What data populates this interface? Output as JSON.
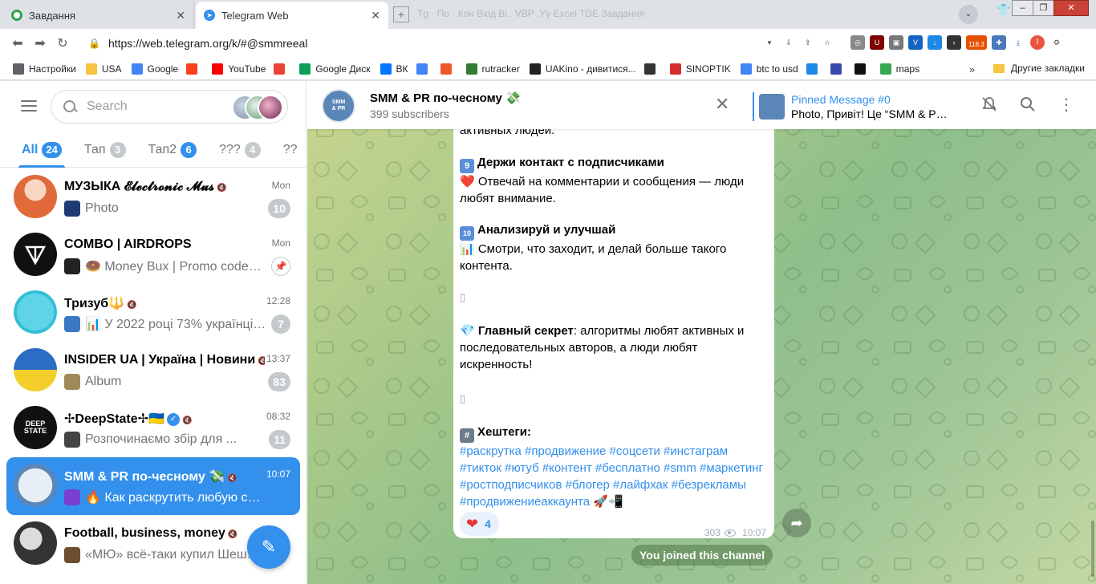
{
  "browser": {
    "tabs": [
      {
        "label": "Завдання"
      },
      {
        "label": "Telegram Web"
      }
    ],
    "ghost_tabs": "Tg · По ·  Кон  Вхід Bi..  VBP .Yy  Excel TDE  Завдання",
    "url": "https://web.telegram.org/k/#@smmreeal",
    "extension_badge": "118.3",
    "profile_initial": "I",
    "bookmarks": [
      {
        "label": "Настройки",
        "icon": "gear-icon",
        "color": "#5f6368"
      },
      {
        "label": "USA",
        "icon": "folder-icon",
        "color": "#f6c343"
      },
      {
        "label": "Google",
        "icon": "google-icon",
        "color": "#4285f4"
      },
      {
        "label": "",
        "icon": "yandex-icon",
        "color": "#fc3f1d"
      },
      {
        "label": "YouTube",
        "icon": "youtube-icon",
        "color": "#ff0000"
      },
      {
        "label": "",
        "icon": "gmail-icon",
        "color": "#ea4335"
      },
      {
        "label": "Google Диск",
        "icon": "drive-icon",
        "color": "#0f9d58"
      },
      {
        "label": "ВК",
        "icon": "vk-icon",
        "color": "#0077ff"
      },
      {
        "label": "",
        "icon": "translate-icon",
        "color": "#4285f4"
      },
      {
        "label": "",
        "icon": "f-icon",
        "color": "#f05a28"
      },
      {
        "label": "rutracker",
        "icon": "rutracker-icon",
        "color": "#2e7d32"
      },
      {
        "label": "UAKino - дивитися...",
        "icon": "uakino-icon",
        "color": "#222222"
      },
      {
        "label": "",
        "icon": "chess-icon",
        "color": "#333333"
      },
      {
        "label": "SINOPTIK",
        "icon": "thermometer-icon",
        "color": "#d32f2f"
      },
      {
        "label": "btc to usd",
        "icon": "google-icon",
        "color": "#4285f4"
      },
      {
        "label": "",
        "icon": "p-icon",
        "color": "#1e88e5"
      },
      {
        "label": "",
        "icon": "k-icon",
        "color": "#3949ab"
      },
      {
        "label": "",
        "icon": "bc-icon",
        "color": "#111111"
      },
      {
        "label": "maps",
        "icon": "maps-icon",
        "color": "#34a853"
      }
    ],
    "bookmarks_more": "»",
    "other_bookmarks": "Другие закладки"
  },
  "sidebar": {
    "search_placeholder": "Search",
    "folders": [
      {
        "label": "All",
        "count": "24",
        "active": true
      },
      {
        "label": "Тап",
        "count": "3"
      },
      {
        "label": "Тап2",
        "count": "6",
        "blue": true
      },
      {
        "label": "???",
        "count": "4"
      },
      {
        "label": "??",
        "count": ""
      }
    ],
    "chats": [
      {
        "title": "МУЗЫКА 𝓔𝓵𝓮𝓬𝓽𝓻𝓸𝓷𝓲𝓬 𝓜𝓾𝓼",
        "time": "Mon",
        "preview": "Photo",
        "badge": "10",
        "muted": true
      },
      {
        "title": "COMBO | AIRDROPS",
        "time": "Mon",
        "preview": "🍩 Money Bux | Promo codes ...",
        "badge": "",
        "pinned": true
      },
      {
        "title": "Тризуб🔱",
        "time": "12:28",
        "preview": "📊 У 2022 році 73% українців бу...",
        "badge": "7",
        "muted": true
      },
      {
        "title": "INSIDER UA | Україна | Новини",
        "time": "13:37",
        "preview": "Album",
        "badge": "83",
        "muted": true
      },
      {
        "title": "✢DeepState✢🇺🇦",
        "time": "08:32",
        "preview": "Розпочинаємо збір для ...",
        "badge": "11",
        "muted": true,
        "verified": true
      },
      {
        "title": "SMM & PR по-чесному 💸",
        "time": "10:07",
        "preview": "🔥 Как раскрутить любую соцсе...",
        "badge": "",
        "selected": true,
        "muted": true
      },
      {
        "title": "Football, business, money",
        "time": "",
        "preview": "«МЮ» всё-таки купил Шеш...",
        "badge": "",
        "muted": true
      }
    ]
  },
  "chat": {
    "title": "SMM & PR по-чесному 💸",
    "subtitle": "399 subscribers",
    "pinned_title": "Pinned Message #0",
    "pinned_text": "Photo, Привіт! Це “SMM & PR ...",
    "message": {
      "top_fragment": "активных людей.",
      "tip9_num": "9",
      "tip9_title": "Держи контакт с подписчиками",
      "tip9_body": "❤️ Отвечай на комментарии и сообщения — люди любят внимание.",
      "tip10_num": "10",
      "tip10_title": "Анализируй и улучшай",
      "tip10_body": "📊 Смотри, что заходит, и делай больше такого контента.",
      "tofu1": "▯",
      "secret_label": "Главный секрет",
      "secret_body": ": алгоритмы любят активных и последовательных авторов, а люди любят искренность!",
      "tofu2": "▯",
      "hashtags_title": "Хештеги:",
      "hashtags": "#раскрутка #продвижение #соцсети #инстаграм #тикток #ютуб #контент #бесплатно #smm #маркетинг #ростподписчиков #блогер #лайфхак #безрекламы #продвижениеаккаунта 🚀📲",
      "reaction_count": "4",
      "views": "303",
      "time": "10:07"
    },
    "service_message": "You joined this channel"
  },
  "colors": {
    "accent": "#3390ec",
    "badge_muted": "#c4c9cc"
  }
}
